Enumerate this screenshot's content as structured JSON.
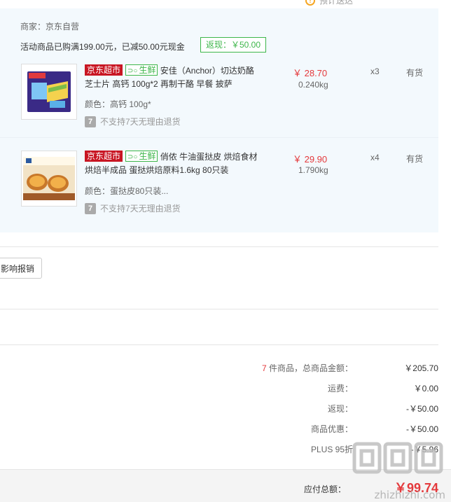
{
  "top_fragment": {
    "text": "预计送达"
  },
  "merchant": "商家：京东自营",
  "promo": {
    "text": "活动商品已购满199.00元，已减50.00元现金",
    "cashback_tag": "返现：￥50.00"
  },
  "items": [
    {
      "tags": [
        "京东超市",
        "生鲜"
      ],
      "title": "安佳（Anchor）切达奶酪芝士片 高钙 100g*2 再制干酪 早餐 披萨",
      "spec": "颜色：高钙 100g*",
      "no_return": "不支持7天无理由退货",
      "price": "￥ 28.70",
      "weight": "0.240kg",
      "qty": "x3",
      "stock": "有货"
    },
    {
      "tags": [
        "京东超市",
        "生鲜"
      ],
      "title": "俏侬 牛油蛋挞皮 烘焙食材烘焙半成品 蛋挞烘焙原料1.6kg 80只装",
      "spec": "颜色：蛋挞皮80只装...",
      "no_return": "不支持7天无理由退货",
      "price": "￥ 29.90",
      "weight": "1.790kg",
      "qty": "x4",
      "stock": "有货"
    }
  ],
  "invoice_button": "影响报销",
  "summary": {
    "count": "7",
    "total_label": "件商品，总商品金额：",
    "total_value": "￥205.70",
    "shipping_label": "运费：",
    "shipping_value": "￥0.00",
    "cashback_label": "返现：",
    "cashback_value": "-￥50.00",
    "discount_label": "商品优惠：",
    "discount_value": "-￥50.00",
    "plus_label": "PLUS 95折",
    "plus_value": "-￥5.96"
  },
  "payable": {
    "label": "应付总额：",
    "value": "￥99.74"
  },
  "watermark": {
    "text": "zhizhizhi.com"
  },
  "colors": {
    "accent_red": "#e4393c",
    "jd_red": "#c81623",
    "fresh_green": "#3db64a",
    "panel_bg": "#f3f9fd"
  }
}
